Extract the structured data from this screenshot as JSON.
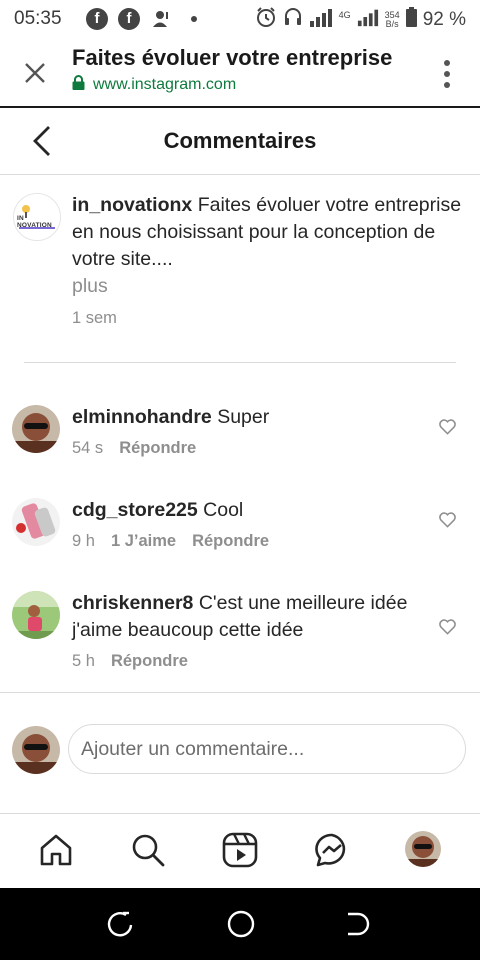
{
  "status_bar": {
    "time": "05:35",
    "network_label": "4G",
    "speed_value": "354",
    "speed_unit": "B/s",
    "battery": "92 %"
  },
  "browser": {
    "title": "Faites évoluer votre entreprise",
    "url": "www.instagram.com"
  },
  "header": {
    "title": "Commentaires"
  },
  "caption": {
    "username": "in_novationx",
    "text": "Faites évoluer votre entreprise en nous choisissant pour la conception de votre site....",
    "more": "plus",
    "time": "1 sem",
    "avatar_text": "IN NOVATION"
  },
  "comments": [
    {
      "username": "elminnohandre",
      "text": "Super",
      "time": "54 s",
      "likes": "",
      "reply": "Répondre"
    },
    {
      "username": "cdg_store225",
      "text": "Cool",
      "time": "9 h",
      "likes": "1 J’aime",
      "reply": "Répondre"
    },
    {
      "username": "chriskenner8",
      "text": "C'est une meilleure idée j'aime beaucoup cette idée",
      "time": "5 h",
      "likes": "",
      "reply": "Répondre"
    }
  ],
  "composer": {
    "placeholder": "Ajouter un commentaire..."
  },
  "colors": {
    "url_green": "#0f7a3d",
    "text": "#262626",
    "muted": "#8e8e8e",
    "divider": "#dbdbdb"
  },
  "icons": {
    "nav": [
      "home-icon",
      "search-icon",
      "reels-icon",
      "messenger-icon",
      "profile-avatar"
    ],
    "system": [
      "back-icon",
      "home-circle-icon",
      "recents-icon"
    ]
  }
}
